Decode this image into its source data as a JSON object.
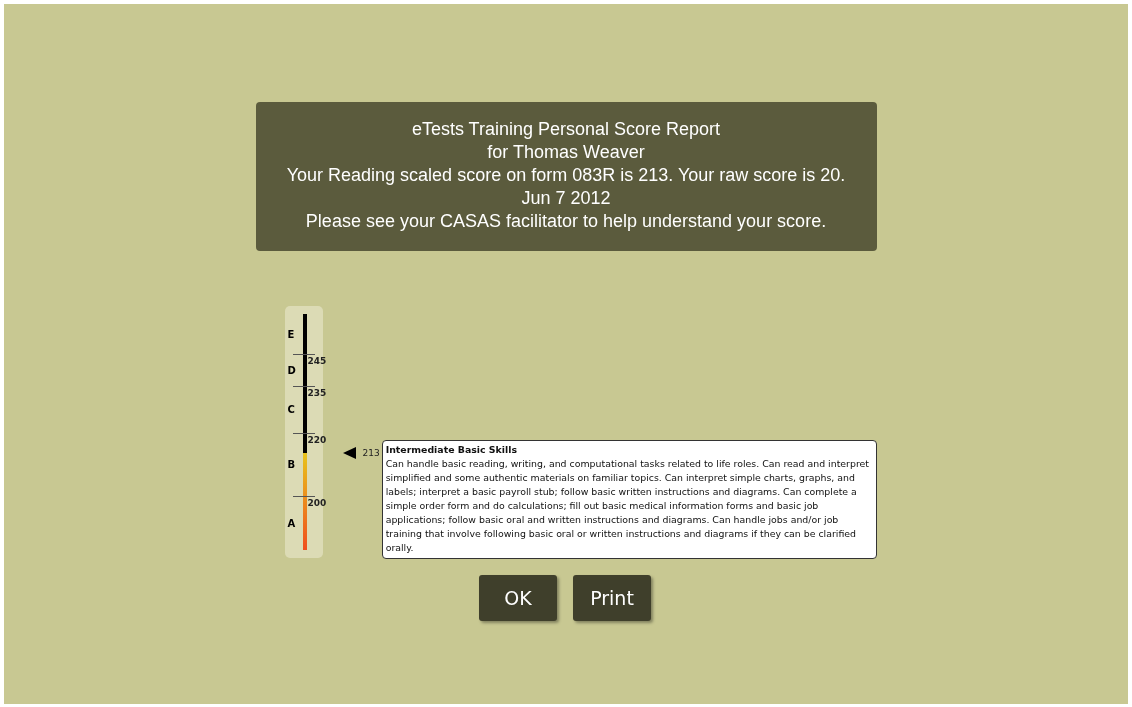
{
  "report": {
    "lines": [
      "eTests Training Personal Score Report",
      "for Thomas Weaver",
      "Your Reading scaled score on form 083R is 213. Your raw score is 20.",
      "Jun 7 2012",
      "Please see your CASAS facilitator to help understand your score."
    ]
  },
  "scale": {
    "bands": [
      {
        "label": "E",
        "tick": "245"
      },
      {
        "label": "D",
        "tick": "235"
      },
      {
        "label": "C",
        "tick": "220"
      },
      {
        "label": "B",
        "tick": "200"
      },
      {
        "label": "A"
      }
    ],
    "level": 0.41,
    "marker": "213"
  },
  "description": {
    "title": "Intermediate Basic Skills",
    "text": "Can handle basic reading, writing, and computational tasks related to life roles. Can read and interpret simplified and some authentic materials on familiar topics. Can interpret simple charts, graphs, and labels; interpret a basic payroll stub; follow basic written instructions and diagrams. Can complete a simple order form and do calculations; fill out basic medical information forms and basic job applications; follow basic oral and written instructions and diagrams. Can handle jobs and/or job training that involve following basic oral or written instructions and diagrams if they can be clarified orally."
  },
  "buttons": [
    "OK",
    "Print"
  ]
}
